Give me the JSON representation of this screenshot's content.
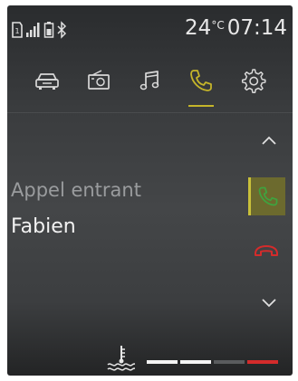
{
  "status": {
    "temperature": "24",
    "temperature_unit": "°C",
    "time": "07:14",
    "icons": [
      "sim-icon",
      "signal-icon",
      "battery-icon",
      "bluetooth-icon"
    ]
  },
  "nav": {
    "tabs": [
      {
        "icon": "car-icon",
        "active": false
      },
      {
        "icon": "radio-icon",
        "active": false
      },
      {
        "icon": "music-icon",
        "active": false
      },
      {
        "icon": "phone-icon",
        "active": true
      },
      {
        "icon": "settings-icon",
        "active": false
      }
    ],
    "active_color": "#c5b52a"
  },
  "call": {
    "title": "Appel entrant",
    "caller": "Fabien"
  },
  "controls": {
    "answer_color": "#3fa33f",
    "reject_color": "#d42b2b"
  },
  "coolant_gauge": {
    "icon": "coolant-temperature-icon",
    "segments_total": 4,
    "segments_lit": 2,
    "warning_color": "#d42b2b"
  }
}
